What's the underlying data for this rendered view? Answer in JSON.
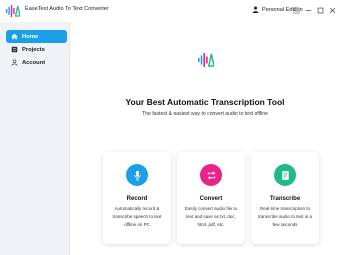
{
  "window": {
    "title": "EaseText Audio To Text Converter",
    "edition": "Personal Edition",
    "controls": [
      "menu-icon",
      "minimize-icon",
      "maximize-icon",
      "close-icon"
    ]
  },
  "sidebar": {
    "items": [
      {
        "label": "Home",
        "icon": "home-icon",
        "active": true
      },
      {
        "label": "Projects",
        "icon": "projects-icon",
        "active": false
      },
      {
        "label": "Account",
        "icon": "account-icon",
        "active": false
      }
    ]
  },
  "hero": {
    "title": "Your Best Automatic Transcription Tool",
    "subtitle": "The fastest & easiest way to convert audio to text offline"
  },
  "cards": [
    {
      "title": "Record",
      "description": "Automatically record & transcribe speech to text offline on PC",
      "icon": "microphone-icon",
      "color": "#1aa0e8"
    },
    {
      "title": "Convert",
      "description": "Easily convert audio file to text and save as txt, doc, html, pdf, etc.",
      "icon": "convert-icon",
      "color": "#e8248a"
    },
    {
      "title": "Transcribe",
      "description": "Real-time transcription to transcribe audio to text in a few seconds",
      "icon": "transcribe-icon",
      "color": "#1fb98a"
    }
  ],
  "colors": {
    "accent": "#1aa0e8",
    "sidebar_bg": "#f1f2f6"
  }
}
